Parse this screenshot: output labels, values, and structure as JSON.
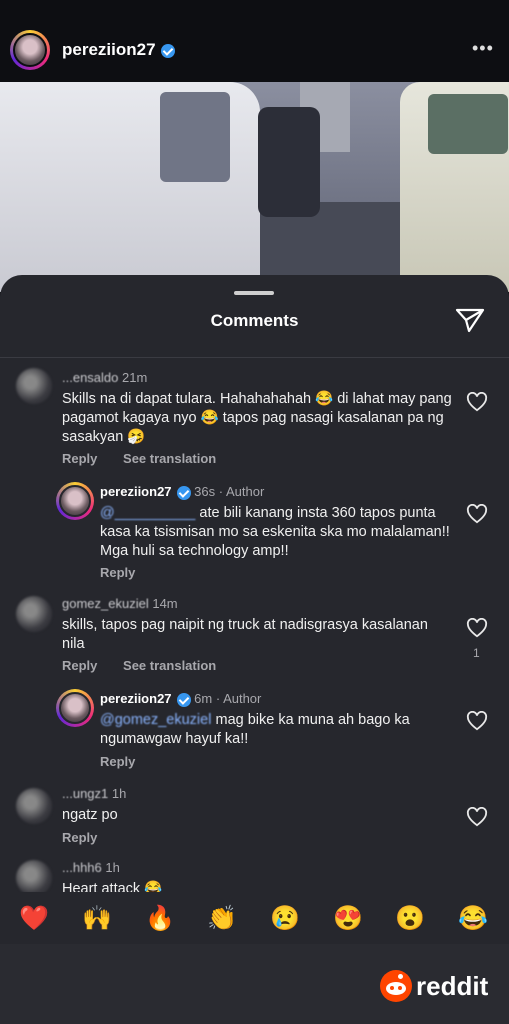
{
  "header": {
    "username": "pereziion27",
    "more_label": "•••"
  },
  "sheet": {
    "title": "Comments"
  },
  "comments": [
    {
      "username": "...ensaldo",
      "time": "21m",
      "text": "Skills na di dapat tularа. Hahahahahah 😂 di lahat may pang pagamot kagaya nyo 😂 tapos pag nasagi kasalanan pa ng sasakyan 🤧",
      "reply_label": "Reply",
      "translate_label": "See translation"
    },
    {
      "username": "pereziion27",
      "time": "36s",
      "author_label": "· Author",
      "mention": "@__________",
      "text": "ate bili kanang insta 360 tapos punta kasa ka tsismisan mo sa eskenita ska mo malalaman!! Mga huli sa technology amp!!",
      "reply_label": "Reply"
    },
    {
      "username": "gomez_ekuziel",
      "time": "14m",
      "text": "skills, tapos pag naipit ng truck at nadisgrasya kasalanan nila",
      "reply_label": "Reply",
      "translate_label": "See translation",
      "likes": "1"
    },
    {
      "username": "pereziion27",
      "time": "6m",
      "author_label": "· Author",
      "mention": "@gomez_ekuziel",
      "text": "mag bike ka muna ah bago ka ngumawgaw hayuf ka!!",
      "reply_label": "Reply"
    },
    {
      "username": "...ungz1",
      "time": "1h",
      "text": "ngatz po",
      "reply_label": "Reply"
    },
    {
      "username": "...hhh6",
      "time": "1h",
      "text": "Heart attack 😂"
    }
  ],
  "reactions": [
    "❤️",
    "🙌",
    "🔥",
    "👏",
    "😢",
    "😍",
    "😮",
    "😂"
  ],
  "watermark": {
    "text": "reddit"
  }
}
